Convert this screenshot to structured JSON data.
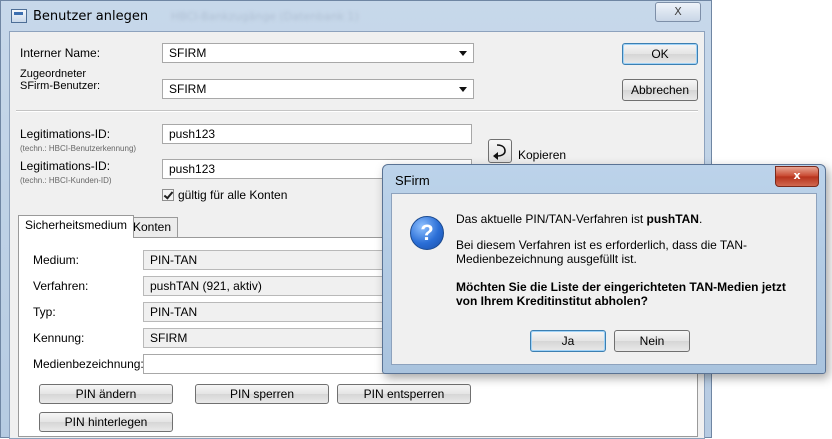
{
  "main_window": {
    "title": "Benutzer anlegen",
    "title_extra": "HBCI-Bankzugänge (Datenbank 1)",
    "close_glyph": "X"
  },
  "form": {
    "internal_name_label": "Interner Name:",
    "internal_name_value": "SFIRM",
    "assigned_user_label_1": "Zugeordneter",
    "assigned_user_label_2": "SFirm-Benutzer:",
    "assigned_user_value": "SFIRM",
    "legit_id_label_1": "Legitimations-ID:",
    "legit_id_hint_1": "(techn.: HBCI-Benutzerkennung)",
    "legit_id_value_1": "push123",
    "legit_id_label_2": "Legitimations-ID:",
    "legit_id_hint_2": "(techn.: HBCI-Kunden-ID)",
    "legit_id_value_2": "push123",
    "valid_all_accounts_label": "gültig für alle Konten",
    "copy_label": "Kopieren"
  },
  "buttons": {
    "ok": "OK",
    "cancel": "Abbrechen"
  },
  "tabs": [
    {
      "label": "Sicherheitsmedium",
      "active": true
    },
    {
      "label": "Konten",
      "active": false
    }
  ],
  "security": {
    "medium_label": "Medium:",
    "medium_value": "PIN-TAN",
    "procedure_label": "Verfahren:",
    "procedure_value": "pushTAN (921, aktiv)",
    "type_label": "Typ:",
    "type_value": "PIN-TAN",
    "id_label": "Kennung:",
    "id_value": "SFIRM",
    "media_name_label": "Medienbezeichnung:",
    "media_name_value": "",
    "pin_change": "PIN ändern",
    "pin_lock": "PIN sperren",
    "pin_unlock": "PIN entsperren",
    "pin_deposit": "PIN hinterlegen"
  },
  "dialog": {
    "title": "SFirm",
    "close_glyph": "x",
    "line1_prefix": "Das aktuelle PIN/TAN-Verfahren ist ",
    "line1_bold": "pushTAN",
    "line1_suffix": ".",
    "line2a": "Bei diesem Verfahren ist es erforderlich, dass die TAN-",
    "line2b": "Medienbezeichnung ausgefüllt ist.",
    "question_a": "Möchten Sie die Liste der eingerichteten TAN-Medien jetzt",
    "question_b": "von Ihrem Kreditinstitut abholen?",
    "yes": "Ja",
    "no": "Nein"
  },
  "colors": {
    "title_bar": "#c7d8ea",
    "dialog_close": "#c7452c",
    "default_button_border": "#3c7fb1"
  }
}
